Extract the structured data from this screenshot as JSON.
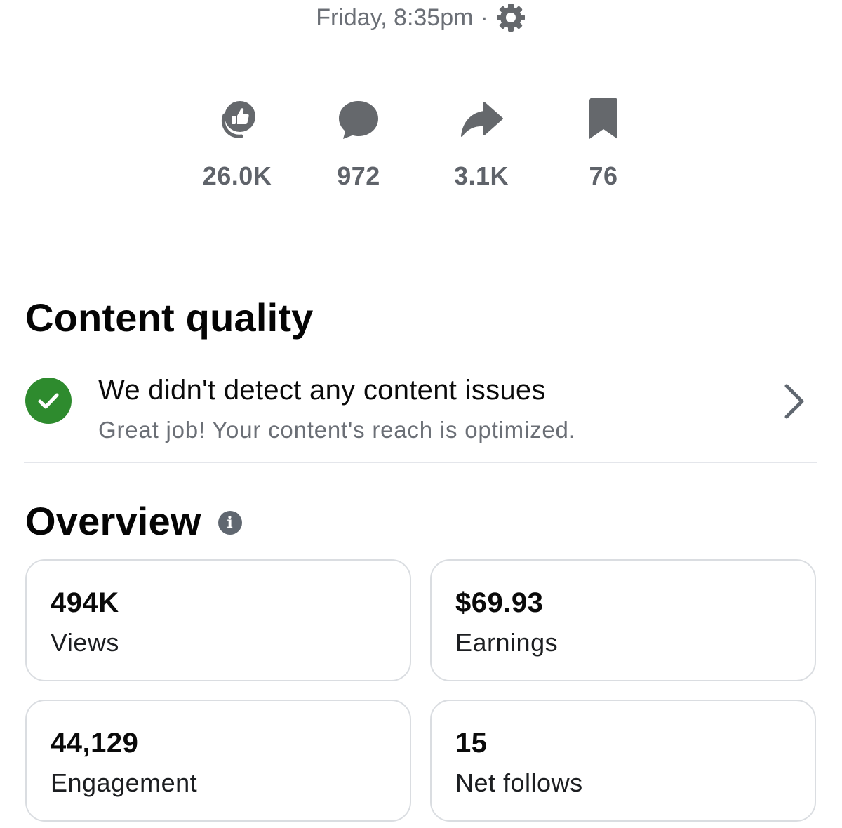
{
  "header": {
    "timestamp": "Friday, 8:35pm",
    "separator": "·",
    "settings_icon": "gear-icon"
  },
  "stats": [
    {
      "icon": "reactions-like-icon",
      "value": "26.0K"
    },
    {
      "icon": "comment-bubble-icon",
      "value": "972"
    },
    {
      "icon": "share-arrow-icon",
      "value": "3.1K"
    },
    {
      "icon": "bookmark-icon",
      "value": "76"
    }
  ],
  "content_quality": {
    "title": "Content quality",
    "headline": "We didn't detect any content issues",
    "subtext": "Great job! Your content's reach is optimized.",
    "status_icon": "check-circle-icon",
    "status_color": "#2e8b2e",
    "action_icon": "chevron-right-icon"
  },
  "overview": {
    "title": "Overview",
    "info_icon": "info-icon",
    "info_glyph": "i",
    "cards": [
      {
        "value": "494K",
        "label": "Views"
      },
      {
        "value": "$69.93",
        "label": "Earnings"
      },
      {
        "value": "44,129",
        "label": "Engagement"
      },
      {
        "value": "15",
        "label": "Net follows"
      }
    ]
  }
}
